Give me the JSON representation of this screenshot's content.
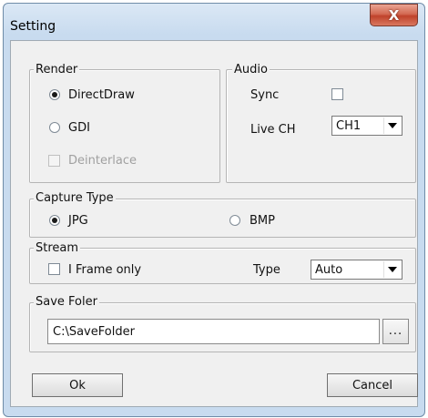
{
  "window": {
    "title": "Setting",
    "close_glyph": "X"
  },
  "render": {
    "legend": "Render",
    "options": [
      {
        "label": "DirectDraw",
        "checked": true
      },
      {
        "label": "GDI",
        "checked": false
      }
    ],
    "deinterlace": {
      "label": "Deinterlace",
      "checked": false,
      "enabled": false
    }
  },
  "audio": {
    "legend": "Audio",
    "sync_label": "Sync",
    "sync_checked": false,
    "live_ch_label": "Live CH",
    "live_ch_value": "CH1"
  },
  "capture_type": {
    "legend": "Capture Type",
    "options": [
      {
        "label": "JPG",
        "checked": true
      },
      {
        "label": "BMP",
        "checked": false
      }
    ]
  },
  "stream": {
    "legend": "Stream",
    "iframe_label": "I Frame only",
    "iframe_checked": false,
    "type_label": "Type",
    "type_value": "Auto"
  },
  "save_folder": {
    "legend": "Save Foler",
    "path": "C:\\SaveFolder",
    "browse_label": "..."
  },
  "buttons": {
    "ok": "Ok",
    "cancel": "Cancel"
  },
  "icons": {
    "close": "close-icon",
    "dropdown": "chevron-down-icon"
  }
}
